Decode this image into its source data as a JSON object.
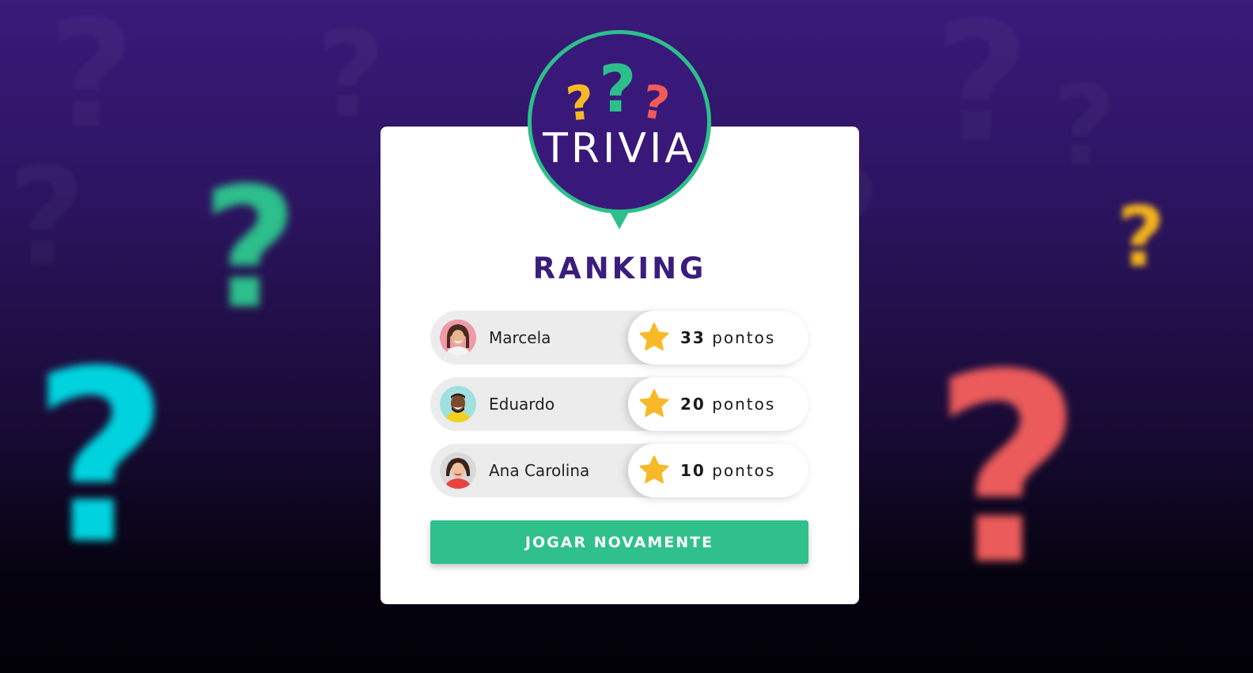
{
  "background": {
    "colors": {
      "top": "#3a1a7a",
      "bottom": "#020107"
    },
    "decorations": [
      {
        "name": "green-question-icon",
        "glyph": "?",
        "color": "#2dbf8b"
      },
      {
        "name": "cyan-question-icon",
        "glyph": "?",
        "color": "#00d3df"
      },
      {
        "name": "yellow-question-icon",
        "glyph": "?",
        "color": "#f2b21c"
      },
      {
        "name": "coral-question-icon",
        "glyph": "?",
        "color": "#ec5b5b"
      }
    ]
  },
  "badge": {
    "title": "TRIVIA",
    "icons": [
      {
        "name": "yellow-question-icon",
        "glyph": "?",
        "color": "#f7b928"
      },
      {
        "name": "green-question-icon",
        "glyph": "?",
        "color": "#2dbf8b"
      },
      {
        "name": "coral-question-icon",
        "glyph": "?",
        "color": "#ef5b5b"
      }
    ],
    "colors": {
      "fill": "#38197a",
      "ring": "#2dbf8b"
    }
  },
  "ranking": {
    "title": "RANKING",
    "players": [
      {
        "name": "Marcela",
        "score": "33",
        "unit": "pontos",
        "avatar_icon": "avatar-marcela"
      },
      {
        "name": "Eduardo",
        "score": "20",
        "unit": "pontos",
        "avatar_icon": "avatar-eduardo"
      },
      {
        "name": "Ana Carolina",
        "score": "10",
        "unit": "pontos",
        "avatar_icon": "avatar-ana-carolina"
      }
    ],
    "score_icon": "star-icon",
    "colors": {
      "star": "#f7b928",
      "title": "#3b1d7e"
    }
  },
  "actions": {
    "play_again_label": "JOGAR NOVAMENTE",
    "color": "#2fc08c"
  }
}
